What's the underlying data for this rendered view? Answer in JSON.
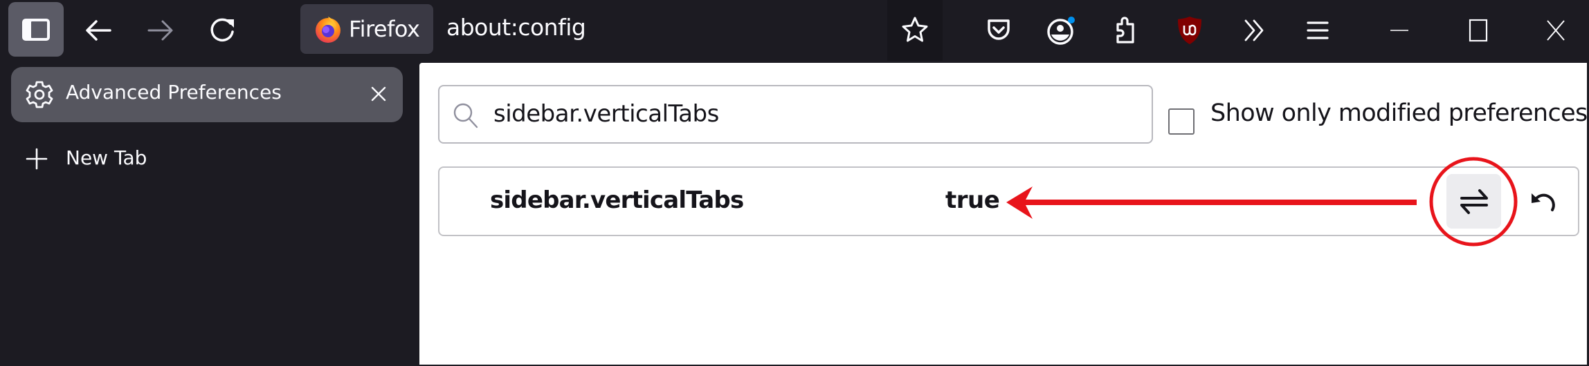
{
  "browser": {
    "identity_label": "Firefox",
    "url": "about:config",
    "toolbar_icons": [
      "sidebar-icon",
      "back-icon",
      "forward-icon",
      "reload-icon",
      "bookmark-star-icon",
      "pocket-icon",
      "account-icon",
      "extensions-icon",
      "ublock-origin-icon",
      "overflow-icon",
      "menu-icon"
    ],
    "window_controls": [
      "minimize-icon",
      "maximize-icon",
      "close-icon"
    ],
    "account_badge_color": "#0090ed",
    "forward_disabled": true
  },
  "sidebar": {
    "tabs": [
      {
        "label": "Advanced Preferences",
        "icon": "gear-icon",
        "active": true
      }
    ],
    "new_tab_label": "New Tab"
  },
  "config": {
    "search_value": "sidebar.verticalTabs",
    "show_modified_label": "Show only modified preferences",
    "show_modified_checked": false,
    "preferences": [
      {
        "name": "sidebar.verticalTabs",
        "value": "true",
        "actions": [
          "toggle-icon",
          "reset-icon"
        ]
      }
    ]
  },
  "annotation": {
    "color": "#e8141b",
    "arrow_points_to": "value",
    "circle_highlights": "toggle-button"
  }
}
